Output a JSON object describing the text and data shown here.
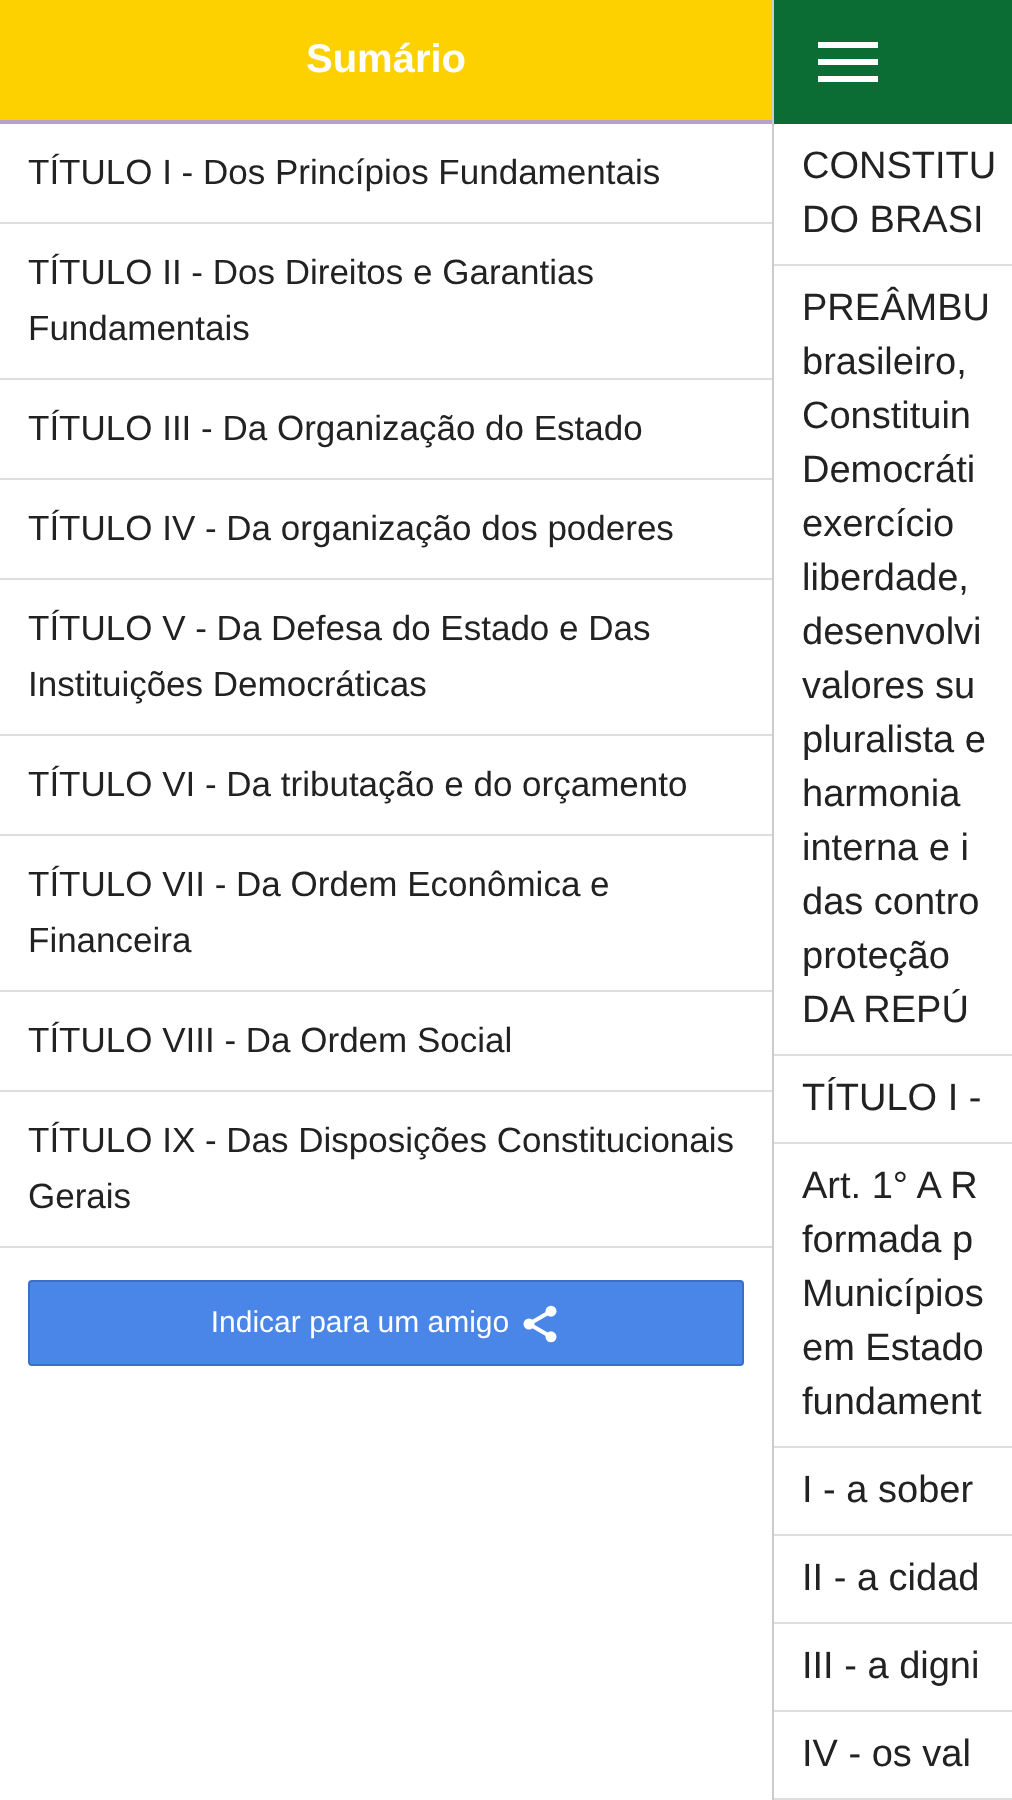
{
  "sidebar": {
    "title": "Sumário",
    "items": [
      "TÍTULO I - Dos Princípios Fundamentais",
      "TÍTULO II - Dos Direitos e Garantias Fundamentais",
      "TÍTULO III - Da Organização do Estado",
      "TÍTULO IV - Da organização dos poderes",
      "TÍTULO V - Da Defesa do Estado e Das Instituições Democráticas",
      "TÍTULO VI - Da tributação e do orçamento",
      "TÍTULO VII - Da Ordem Econômica e Financeira",
      "TÍTULO VIII - Da Ordem Social",
      "TÍTULO IX - Das Disposições Constitucionais Gerais"
    ],
    "share_button": "Indicar para um amigo"
  },
  "content": {
    "rows": [
      {
        "lines": [
          "CONSTITU",
          "DO BRASI"
        ]
      },
      {
        "lines": [
          "PREÂMBU",
          "brasileiro,",
          "Constituin",
          "Democráti",
          "exercício",
          "liberdade,",
          "desenvolvi",
          "valores su",
          "pluralista e",
          "harmonia",
          "interna e i",
          "das contro",
          "proteção",
          "DA REPÚ"
        ]
      },
      {
        "lines": [
          "TÍTULO I -"
        ]
      },
      {
        "lines": [
          "Art. 1° A R",
          "formada p",
          "Municípios",
          "em Estado",
          "fundament"
        ]
      },
      {
        "lines": [
          "I - a sober"
        ]
      },
      {
        "lines": [
          "II - a cidad"
        ]
      },
      {
        "lines": [
          "III - a digni"
        ]
      },
      {
        "lines": [
          "IV - os val"
        ]
      }
    ]
  }
}
